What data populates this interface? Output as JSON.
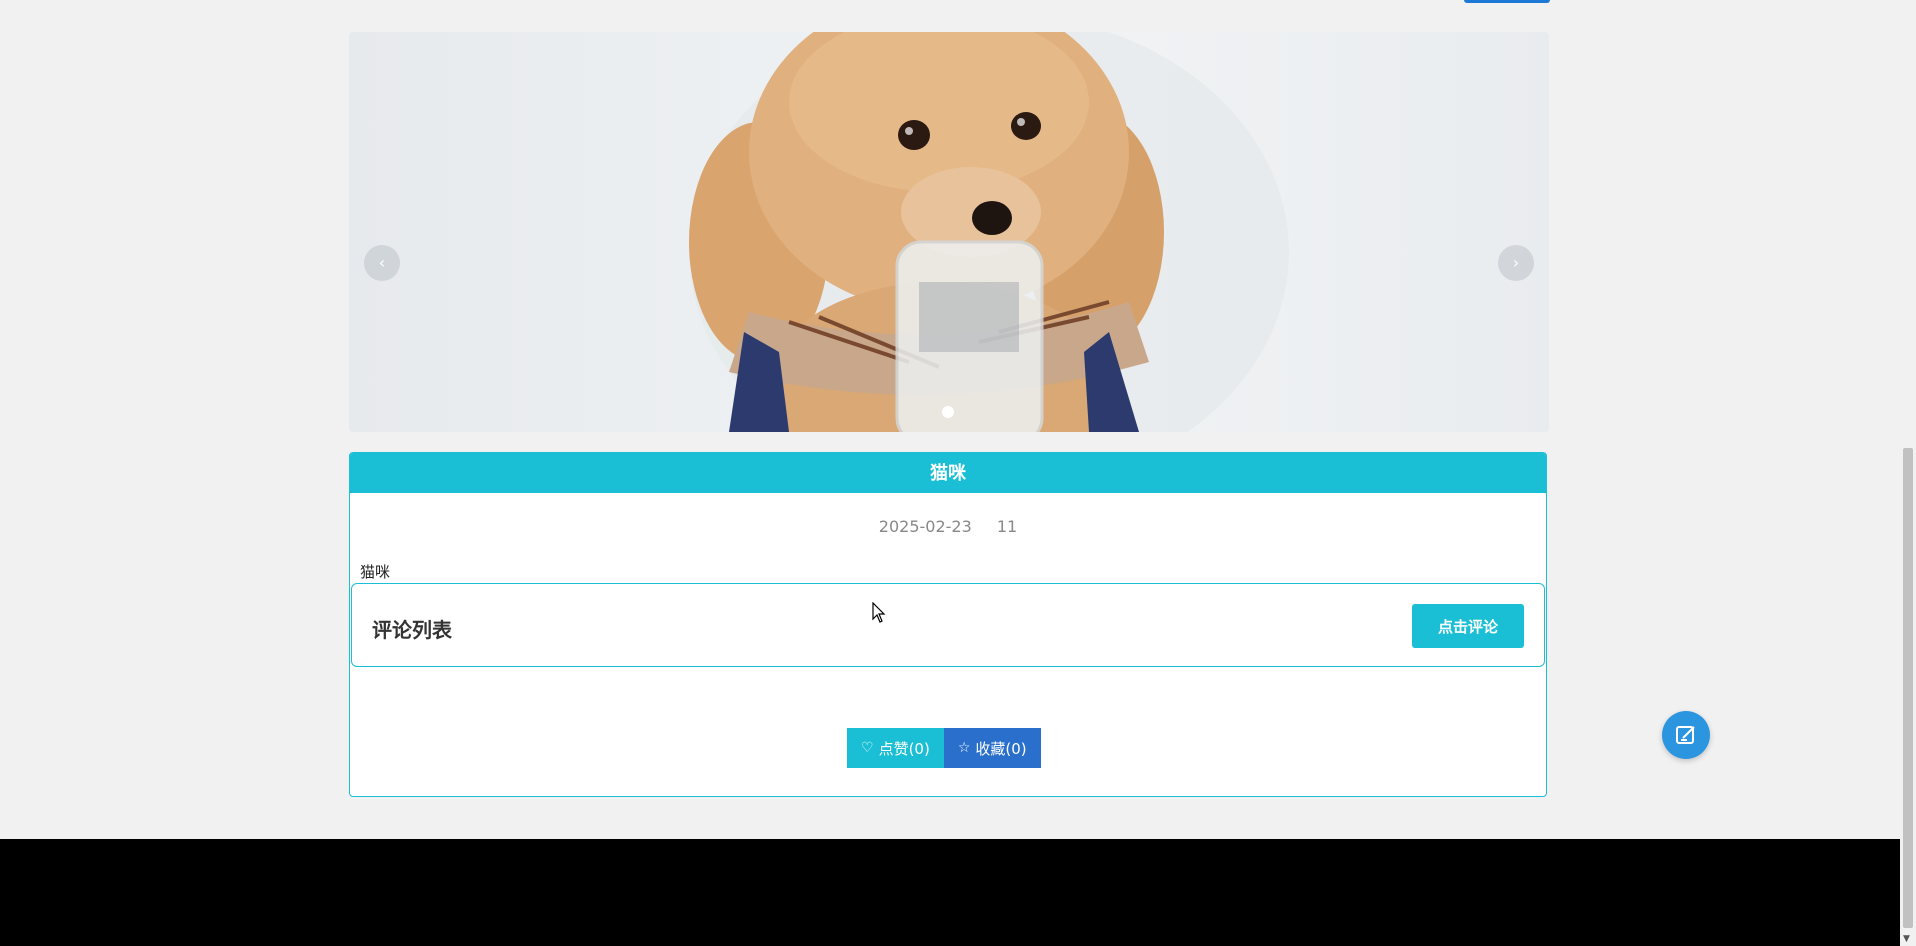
{
  "carousel": {
    "prev_icon": "chevron-left-icon",
    "next_icon": "chevron-right-icon",
    "prev_glyph": "‹",
    "next_glyph": "›",
    "slide_image": "poodle-dog-photo"
  },
  "article": {
    "title": "猫咪",
    "date": "2025-02-23",
    "views": "11",
    "content": "猫咪"
  },
  "comments": {
    "title": "评论列表",
    "button_label": "点击评论"
  },
  "actions": {
    "like_label": "点赞(0)",
    "collect_label": "收藏(0)",
    "like_icon": "heart-icon",
    "collect_icon": "star-icon"
  },
  "colors": {
    "accent": "#1bbfd5",
    "collect": "#2a6fcc",
    "float": "#2c95e0",
    "footer": "#000000"
  }
}
